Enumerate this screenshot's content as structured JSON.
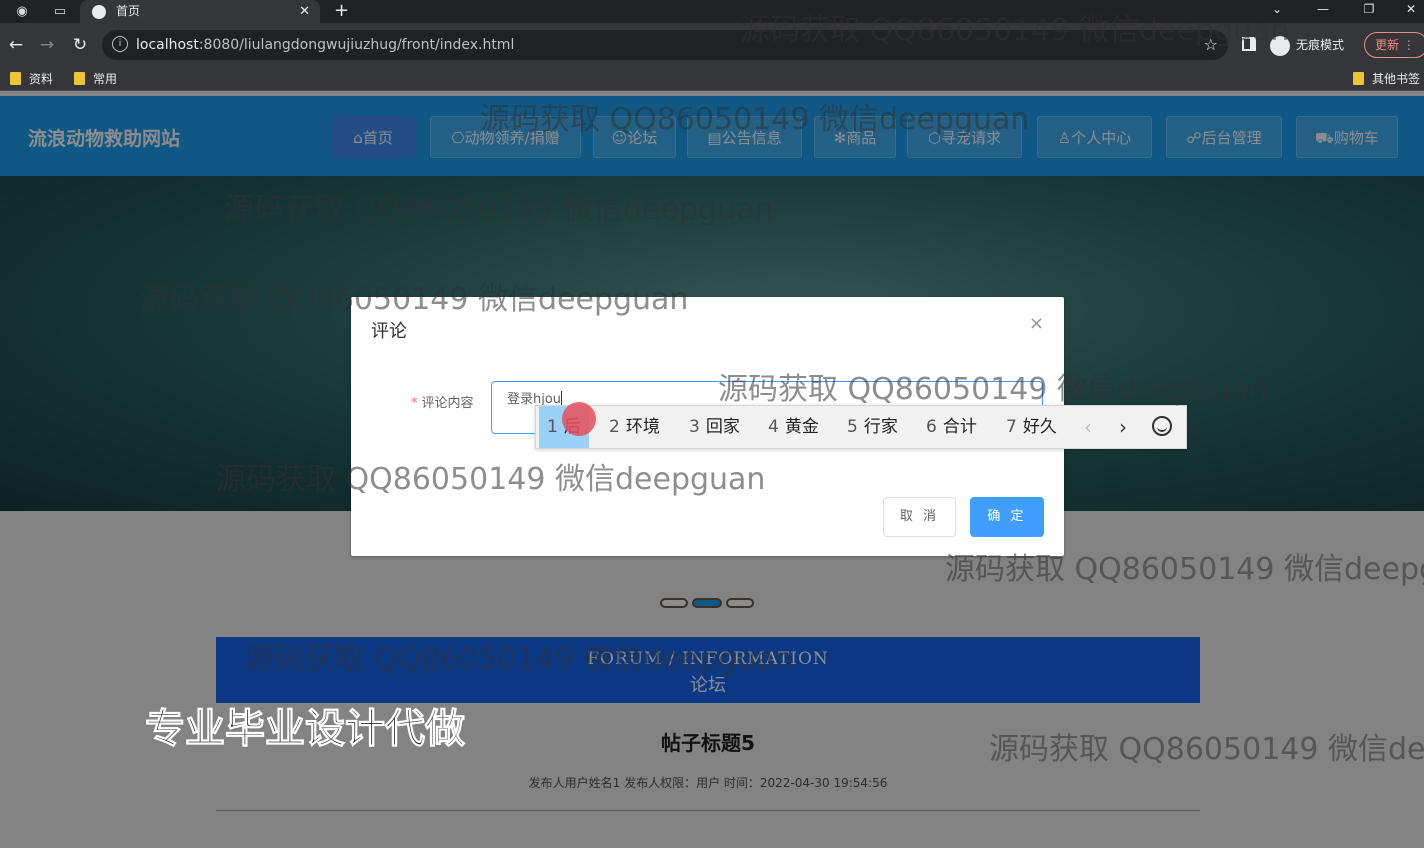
{
  "browser": {
    "tab_title": "首页",
    "url_host": "localhost",
    "url_rest": ":8080/liulangdongwujiuzhug/front/index.html",
    "incognito_label": "无痕模式",
    "update_label": "更新",
    "bookmarks": [
      "资料",
      "常用"
    ],
    "other_bookmarks": "其他书签"
  },
  "site": {
    "title": "流浪动物救助网站",
    "nav": [
      {
        "icon": "⌂",
        "label": "首页"
      },
      {
        "icon": "⎔",
        "label": "动物领养/捐赠"
      },
      {
        "icon": "☺",
        "label": "论坛"
      },
      {
        "icon": "▤",
        "label": "公告信息"
      },
      {
        "icon": "✻",
        "label": "商品"
      },
      {
        "icon": "⬡",
        "label": "寻宠请求"
      },
      {
        "icon": "♙",
        "label": "个人中心"
      },
      {
        "icon": "☍",
        "label": "后台管理"
      },
      {
        "icon": "⛟",
        "label": "购物车"
      }
    ]
  },
  "section": {
    "en": "FORUM / INFORMATION",
    "cn": "论坛"
  },
  "post": {
    "title": "帖子标题5",
    "meta": "发布人用户姓名1   发布人权限：用户   时间：2022-04-30 19:54:56"
  },
  "dialog": {
    "title": "评论",
    "label": "评论内容",
    "input_value": "登录hjou",
    "cancel": "取 消",
    "confirm": "确 定"
  },
  "ime": {
    "candidates": [
      {
        "num": "1",
        "text": "后"
      },
      {
        "num": "2",
        "text": "环境"
      },
      {
        "num": "3",
        "text": "回家"
      },
      {
        "num": "4",
        "text": "黄金"
      },
      {
        "num": "5",
        "text": "行家"
      },
      {
        "num": "6",
        "text": "合计"
      },
      {
        "num": "7",
        "text": "好久"
      }
    ]
  },
  "watermark": "源码获取 QQ86050149 微信deepguan",
  "promo": "专业毕业设计代做"
}
